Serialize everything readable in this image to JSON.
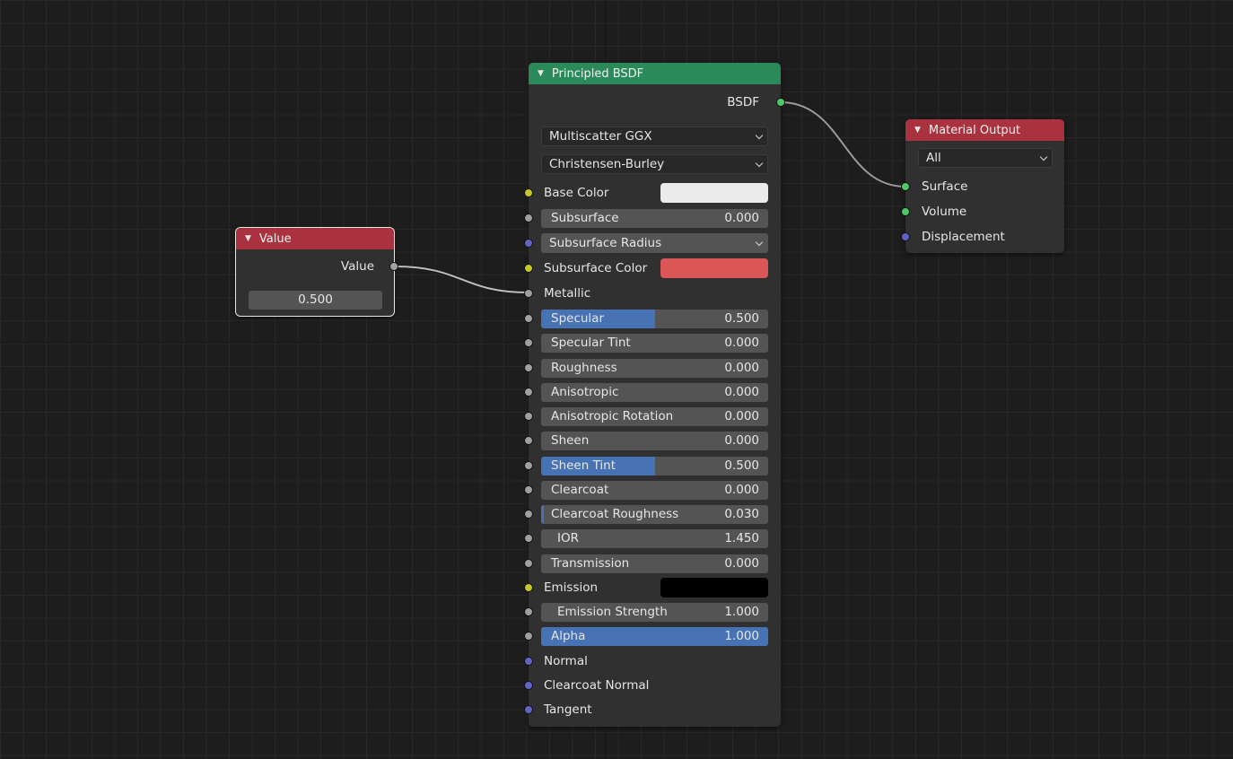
{
  "colors": {
    "bsdf_header": "#2b8a5a",
    "output_header": "#a9323e",
    "value_header": "#a9323e",
    "slider_fill": "#4772b3",
    "base_color": "#ebebeb",
    "subsurface_color": "#db5656",
    "emission_color": "#000000"
  },
  "value_node": {
    "title": "Value",
    "output_label": "Value",
    "value": "0.500",
    "header_icon": "triangle-down-icon"
  },
  "bsdf_node": {
    "title": "Principled BSDF",
    "output_label": "BSDF",
    "distribution": "Multiscatter GGX",
    "subsurface_method": "Christensen-Burley",
    "inputs": {
      "base_color": "Base Color",
      "subsurface": {
        "label": "Subsurface",
        "value": "0.000",
        "fraction": 0
      },
      "subsurface_radius": "Subsurface Radius",
      "subsurface_color": "Subsurface Color",
      "metallic": "Metallic",
      "specular": {
        "label": "Specular",
        "value": "0.500",
        "fraction": 0.5
      },
      "specular_tint": {
        "label": "Specular Tint",
        "value": "0.000",
        "fraction": 0
      },
      "roughness": {
        "label": "Roughness",
        "value": "0.000",
        "fraction": 0
      },
      "anisotropic": {
        "label": "Anisotropic",
        "value": "0.000",
        "fraction": 0
      },
      "anisotropic_rotation": {
        "label": "Anisotropic Rotation",
        "value": "0.000",
        "fraction": 0
      },
      "sheen": {
        "label": "Sheen",
        "value": "0.000",
        "fraction": 0
      },
      "sheen_tint": {
        "label": "Sheen Tint",
        "value": "0.500",
        "fraction": 0.5
      },
      "clearcoat": {
        "label": "Clearcoat",
        "value": "0.000",
        "fraction": 0
      },
      "clearcoat_roughness": {
        "label": "Clearcoat Roughness",
        "value": "0.030",
        "fraction": 0.03
      },
      "ior": {
        "label": "IOR",
        "value": "1.450"
      },
      "transmission": {
        "label": "Transmission",
        "value": "0.000",
        "fraction": 0
      },
      "emission": "Emission",
      "emission_strength": {
        "label": "Emission Strength",
        "value": "1.000"
      },
      "alpha": {
        "label": "Alpha",
        "value": "1.000",
        "fraction": 1
      },
      "normal": "Normal",
      "clearcoat_normal": "Clearcoat Normal",
      "tangent": "Tangent"
    }
  },
  "output_node": {
    "title": "Material Output",
    "target": "All",
    "inputs": {
      "surface": "Surface",
      "volume": "Volume",
      "displacement": "Displacement"
    }
  }
}
